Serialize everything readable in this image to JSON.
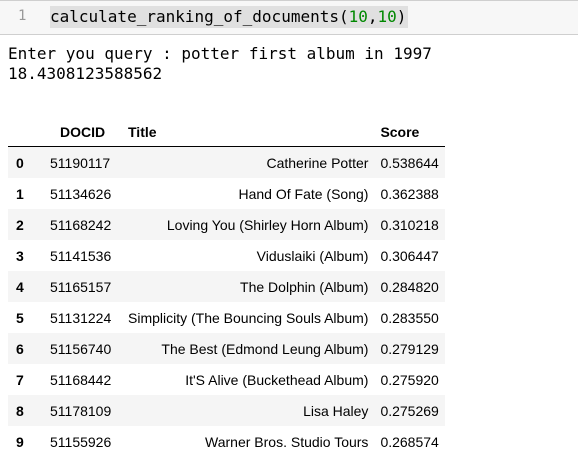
{
  "cell": {
    "line_number": "1",
    "code_function": "calculate_ranking_of_documents",
    "code_arg1": "10",
    "code_arg2": "10"
  },
  "output": {
    "prompt_line": "Enter you query : potter first album in 1997",
    "value_line": "18.4308123588562"
  },
  "table": {
    "columns": [
      "",
      "DOCID",
      "Title",
      "Score"
    ],
    "rows": [
      {
        "index": "0",
        "docid": "51190117",
        "title": "Catherine Potter",
        "score": "0.538644"
      },
      {
        "index": "1",
        "docid": "51134626",
        "title": "Hand Of Fate (Song)",
        "score": "0.362388"
      },
      {
        "index": "2",
        "docid": "51168242",
        "title": "Loving You (Shirley Horn Album)",
        "score": "0.310218"
      },
      {
        "index": "3",
        "docid": "51141536",
        "title": "Viduslaiki (Album)",
        "score": "0.306447"
      },
      {
        "index": "4",
        "docid": "51165157",
        "title": "The Dolphin (Album)",
        "score": "0.284820"
      },
      {
        "index": "5",
        "docid": "51131224",
        "title": "Simplicity (The Bouncing Souls Album)",
        "score": "0.283550"
      },
      {
        "index": "6",
        "docid": "51156740",
        "title": "The Best (Edmond Leung Album)",
        "score": "0.279129"
      },
      {
        "index": "7",
        "docid": "51168442",
        "title": "It'S Alive (Buckethead Album)",
        "score": "0.275920"
      },
      {
        "index": "8",
        "docid": "51178109",
        "title": "Lisa Haley",
        "score": "0.275269"
      },
      {
        "index": "9",
        "docid": "51155926",
        "title": "Warner Bros. Studio Tours",
        "score": "0.268574"
      }
    ]
  },
  "colors": {
    "cell_background": "#f7f7f7",
    "number_literal": "#008800",
    "striped_row": "#f5f5f5"
  }
}
